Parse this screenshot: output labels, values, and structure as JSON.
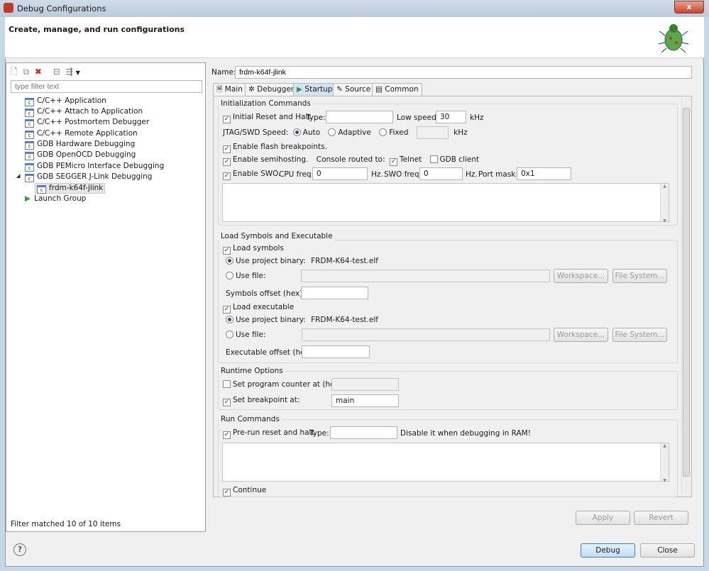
{
  "window": {
    "title": "Debug Configurations",
    "close": "x"
  },
  "header": {
    "title": "Create, manage, and run configurations"
  },
  "left": {
    "filter_placeholder": "type filter text",
    "items": [
      {
        "label": "C/C++ Application"
      },
      {
        "label": "C/C++ Attach to Application"
      },
      {
        "label": "C/C++ Postmortem Debugger"
      },
      {
        "label": "C/C++ Remote Application"
      },
      {
        "label": "GDB Hardware Debugging"
      },
      {
        "label": "GDB OpenOCD Debugging"
      },
      {
        "label": "GDB PEMicro Interface Debugging"
      },
      {
        "label": "GDB SEGGER J-Link Debugging"
      }
    ],
    "child": "frdm-k64f-jlink",
    "launch_group": "Launch Group",
    "status": "Filter matched 10 of 10 items"
  },
  "name": {
    "label": "Name:",
    "value": "frdm-k64f-jlink"
  },
  "tabs": [
    "Main",
    "Debugger",
    "Startup",
    "Source",
    "Common"
  ],
  "init": {
    "title": "Initialization Commands",
    "reset": "Initial Reset and Halt.",
    "type": "Type:",
    "type_value": "",
    "low_speed": "Low speed:",
    "low_speed_value": "30",
    "khz": "kHz",
    "jtag": "JTAG/SWD Speed:",
    "auto": "Auto",
    "adaptive": "Adaptive",
    "fixed": "Fixed",
    "fixed_value": "",
    "flash": "Enable flash breakpoints.",
    "semi": "Enable semihosting.",
    "console": "Console routed to:",
    "telnet": "Telnet",
    "gdb_client": "GDB client",
    "swo": "Enable SWO.",
    "cpu": "CPU freq:",
    "cpu_value": "0",
    "hz": "Hz.",
    "swo_freq": "SWO freq:",
    "swo_value": "0",
    "hz2": "Hz.",
    "port": "Port mask:",
    "port_value": "0x1"
  },
  "load": {
    "title": "Load Symbols and Executable",
    "symbols": "Load symbols",
    "use_proj": "Use project binary:",
    "binary": "FRDM-K64-test.elf",
    "use_file": "Use file:",
    "workspace": "Workspace...",
    "filesystem": "File System...",
    "sym_offset": "Symbols offset (hex):",
    "executable": "Load executable",
    "exe_offset": "Executable offset (hex):"
  },
  "runtime": {
    "title": "Runtime Options",
    "pc": "Set program counter at (hex):",
    "bp": "Set breakpoint at:",
    "bp_value": "main"
  },
  "run": {
    "title": "Run Commands",
    "prerun": "Pre-run reset and halt.",
    "type": "Type:",
    "note": "Disable it when debugging in RAM!",
    "continue": "Continue"
  },
  "buttons": {
    "apply": "Apply",
    "revert": "Revert",
    "debug": "Debug",
    "close": "Close",
    "help": "?"
  }
}
